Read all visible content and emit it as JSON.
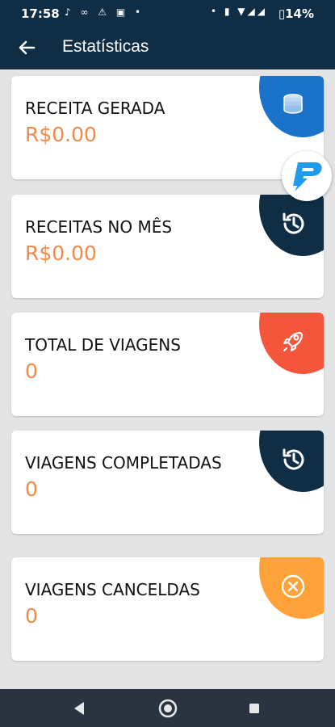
{
  "status_bar": {
    "time": "17:58",
    "battery": "14%"
  },
  "app_bar": {
    "title": "Estatísticas"
  },
  "cards": [
    {
      "label": "RECEITA GERADA",
      "value": "R$0.00",
      "icon": "coins-icon",
      "color": "#1a73c9"
    },
    {
      "label": "RECEITAS NO MÊS",
      "value": "R$0.00",
      "icon": "history-icon",
      "color": "#0f2d44"
    },
    {
      "label": "TOTAL DE VIAGENS",
      "value": "0",
      "icon": "rocket-icon",
      "color": "#f4563b"
    },
    {
      "label": "VIAGENS COMPLETADAS",
      "value": "0",
      "icon": "history-icon",
      "color": "#0f2d44"
    },
    {
      "label": "VIAGENS CANCELDAS",
      "value": "0",
      "icon": "cancel-icon",
      "color": "#ffa23a"
    }
  ],
  "colors": {
    "header": "#0f2d44",
    "value_text": "#ef8a4a",
    "nav_bar": "#2a3440"
  }
}
